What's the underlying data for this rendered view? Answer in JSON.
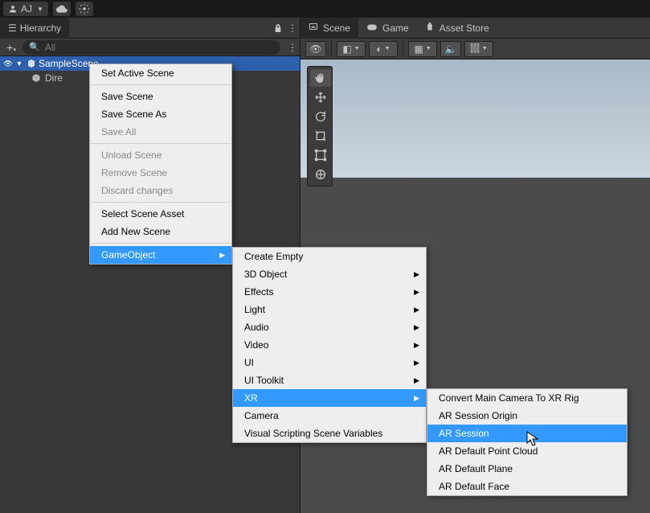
{
  "appbar": {
    "account": "AJ"
  },
  "leftPanel": {
    "tab": "Hierarchy",
    "searchPlaceholder": "All",
    "sceneName": "SampleScene",
    "childName": "Dire"
  },
  "rightPanel": {
    "tabs": {
      "scene": "Scene",
      "game": "Game",
      "assetStore": "Asset Store"
    }
  },
  "menu1": {
    "setActive": "Set Active Scene",
    "saveScene": "Save Scene",
    "saveSceneAs": "Save Scene As",
    "saveAll": "Save All",
    "unload": "Unload Scene",
    "remove": "Remove Scene",
    "discard": "Discard changes",
    "selectAsset": "Select Scene Asset",
    "addNew": "Add New Scene",
    "gameObject": "GameObject"
  },
  "menu2": {
    "createEmpty": "Create Empty",
    "obj3d": "3D Object",
    "effects": "Effects",
    "light": "Light",
    "audio": "Audio",
    "video": "Video",
    "ui": "UI",
    "uiToolkit": "UI Toolkit",
    "xr": "XR",
    "camera": "Camera",
    "vssv": "Visual Scripting Scene Variables"
  },
  "menu3": {
    "convert": "Convert Main Camera To XR Rig",
    "arSessionOrigin": "AR Session Origin",
    "arSession": "AR Session",
    "arDefaultPointCloud": "AR Default Point Cloud",
    "arDefaultPlane": "AR Default Plane",
    "arDefaultFace": "AR Default Face"
  }
}
